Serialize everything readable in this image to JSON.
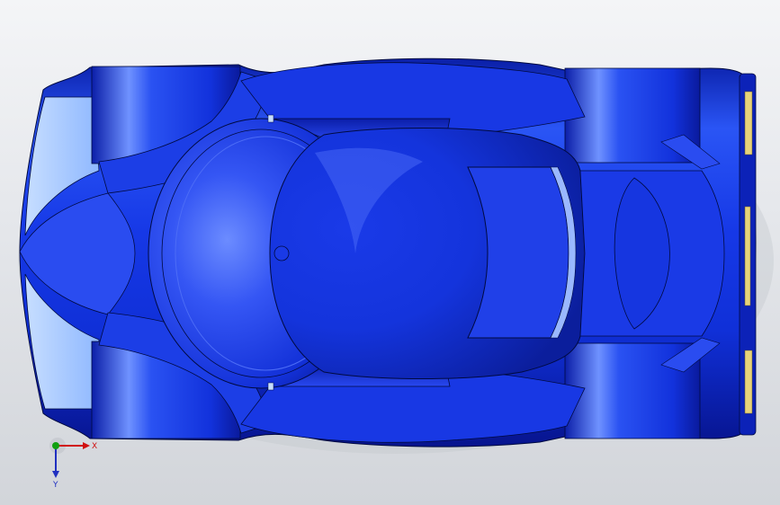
{
  "viewport": {
    "background_top": "#f4f5f7",
    "background_bottom": "#d2d5da",
    "model_color": "#1030e0",
    "model_highlight": "#7ea0ff",
    "model_shadow": "#08128a",
    "glass_color": "#a8ccff",
    "edge_color": "#000a40"
  },
  "triad": {
    "x_label": "X",
    "y_label": "Y",
    "x_color": "#d01010",
    "y_color": "#2030c0",
    "z_color": "#10a010"
  }
}
